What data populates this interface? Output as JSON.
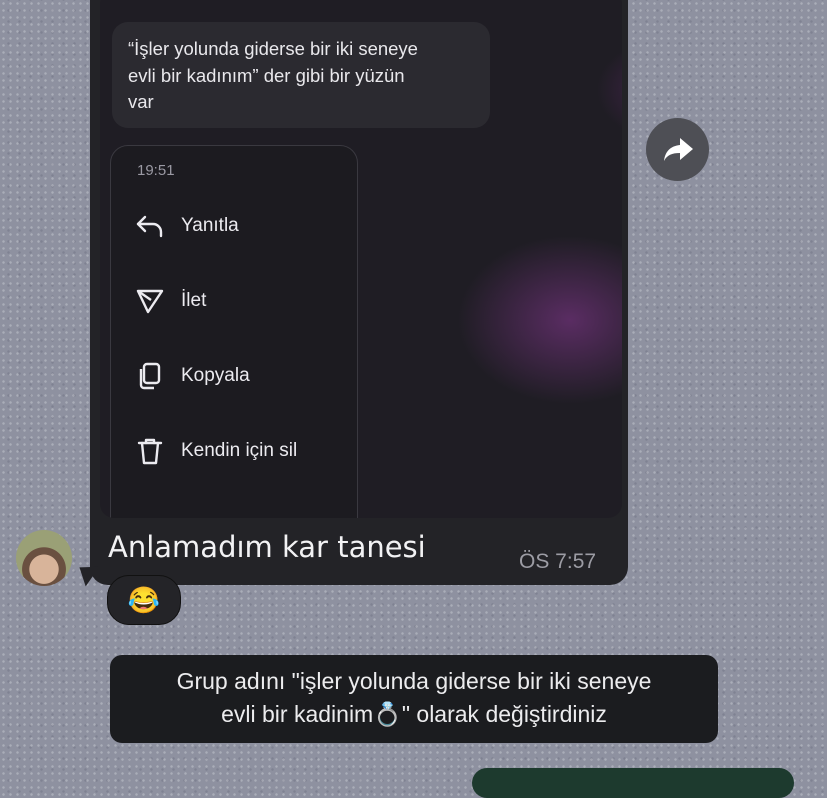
{
  "quoted_message": {
    "line1": "“İşler yolunda giderse bir iki seneye",
    "line2": "evli bir kadınım” der gibi bir yüzün",
    "line3": "var"
  },
  "context_menu": {
    "time": "19:51",
    "items": [
      {
        "label": "Yanıtla",
        "icon": "reply-icon"
      },
      {
        "label": "İlet",
        "icon": "send-icon"
      },
      {
        "label": "Kopyala",
        "icon": "copy-icon"
      },
      {
        "label": "Kendin için sil",
        "icon": "trash-icon"
      }
    ]
  },
  "message": {
    "text": "Anlamadım kar tanesi",
    "time": "ÖS 7:57",
    "reaction": "😂"
  },
  "system_message": {
    "line1": "Grup adını \"işler yolunda giderse bir iki seneye",
    "line2": "evli bir kadinim💍\" olarak değiştirdiniz"
  }
}
